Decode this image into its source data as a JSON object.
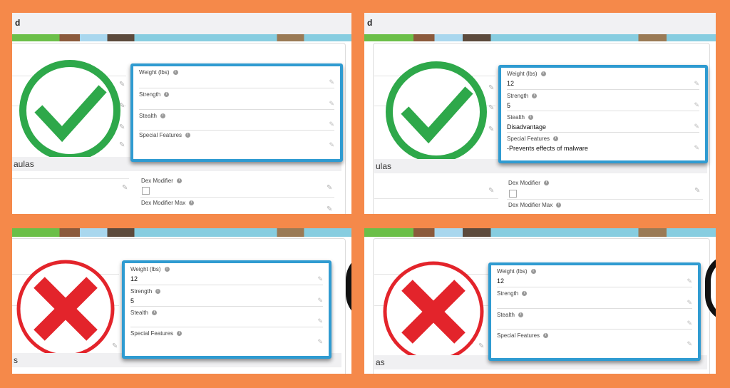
{
  "panels": [
    {
      "header": "d",
      "status": "valid",
      "section_label": "aulas",
      "fields": [
        {
          "label": "Weight (lbs)",
          "value": ""
        },
        {
          "label": "Strength",
          "value": ""
        },
        {
          "label": "Stealth",
          "value": ""
        },
        {
          "label": "Special Features",
          "value": ""
        }
      ],
      "dex_modifier_label": "Dex Modifier",
      "dex_modifier_max_label": "Dex Modifier Max"
    },
    {
      "header": "d",
      "status": "valid",
      "section_label": "ulas",
      "fields": [
        {
          "label": "Weight (lbs)",
          "value": "12"
        },
        {
          "label": "Strength",
          "value": "5"
        },
        {
          "label": "Stealth",
          "value": "Disadvantage"
        },
        {
          "label": "Special Features",
          "value": "-Prevents effects of malware"
        }
      ],
      "dex_modifier_label": "Dex Modifier",
      "dex_modifier_max_label": "Dex Modifier Max"
    },
    {
      "status": "invalid",
      "section_label": "s",
      "fields": [
        {
          "label": "Weight (lbs)",
          "value": "12"
        },
        {
          "label": "Strength",
          "value": "5"
        },
        {
          "label": "Stealth",
          "value": ""
        },
        {
          "label": "Special Features",
          "value": ""
        }
      ]
    },
    {
      "status": "invalid",
      "section_label": "as",
      "fields": [
        {
          "label": "Weight (lbs)",
          "value": "12"
        },
        {
          "label": "Strength",
          "value": ""
        },
        {
          "label": "Stealth",
          "value": ""
        },
        {
          "label": "Special Features",
          "value": ""
        }
      ]
    }
  ],
  "icons": {
    "valid": "check-circle-icon",
    "invalid": "x-circle-icon",
    "info": "info-icon",
    "edit": "pencil-icon"
  },
  "colors": {
    "background": "#f5894a",
    "highlight_border": "#2f9bd1",
    "valid_green": "#2ea84a",
    "invalid_red": "#e3242b"
  }
}
